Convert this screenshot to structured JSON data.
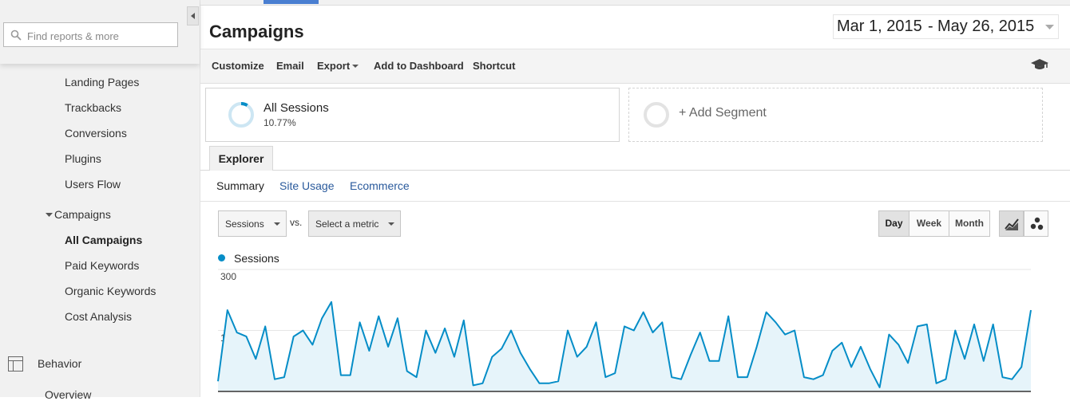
{
  "sidebar": {
    "search_placeholder": "Find reports & more",
    "items": [
      {
        "label": "Landing Pages"
      },
      {
        "label": "Trackbacks"
      },
      {
        "label": "Conversions"
      },
      {
        "label": "Plugins"
      },
      {
        "label": "Users Flow"
      }
    ],
    "campaigns": {
      "label": "Campaigns",
      "children": [
        {
          "label": "All Campaigns",
          "active": true
        },
        {
          "label": "Paid Keywords"
        },
        {
          "label": "Organic Keywords"
        },
        {
          "label": "Cost Analysis"
        }
      ]
    },
    "behavior": {
      "label": "Behavior",
      "icon": "behavior-icon",
      "next_item": "Overview"
    }
  },
  "header": {
    "title": "Campaigns",
    "date_start": "Mar 1, 2015",
    "date_sep": "-",
    "date_end": "May 26, 2015"
  },
  "toolbar": {
    "customize": "Customize",
    "email": "Email",
    "export": "Export",
    "add_to_dashboard": "Add to Dashboard",
    "shortcut": "Shortcut"
  },
  "segments": {
    "primary": {
      "title": "All Sessions",
      "percent": "10.77%"
    },
    "add": "+ Add Segment"
  },
  "explorer": {
    "tab": "Explorer",
    "subtabs": {
      "summary": "Summary",
      "site_usage": "Site Usage",
      "ecommerce": "Ecommerce"
    }
  },
  "controls": {
    "metric": "Sessions",
    "vs": "vs.",
    "compare_metric": "Select a metric",
    "granularity": {
      "day": "Day",
      "week": "Week",
      "month": "Month",
      "selected": "Day"
    }
  },
  "colors": {
    "series": "#058dc7",
    "accent": "#4a7fd1",
    "link": "#2a5a9c"
  },
  "chart_data": {
    "type": "area",
    "series": [
      {
        "name": "Sessions",
        "values": [
          25,
          200,
          145,
          135,
          80,
          160,
          30,
          35,
          135,
          150,
          115,
          180,
          220,
          40,
          40,
          170,
          100,
          185,
          110,
          180,
          50,
          35,
          150,
          95,
          155,
          85,
          175,
          15,
          20,
          85,
          105,
          150,
          95,
          55,
          20,
          20,
          25,
          150,
          85,
          110,
          170,
          35,
          45,
          160,
          150,
          195,
          145,
          170,
          35,
          30,
          90,
          145,
          75,
          75,
          185,
          35,
          35,
          110,
          195,
          170,
          140,
          150,
          35,
          30,
          40,
          100,
          120,
          60,
          110,
          55,
          10,
          140,
          115,
          70,
          160,
          165,
          20,
          30,
          150,
          80,
          165,
          75,
          165,
          35,
          30,
          60,
          200
        ]
      }
    ],
    "ylim": [
      0,
      300
    ],
    "yticks": [
      "300",
      "150"
    ],
    "grid": true
  }
}
